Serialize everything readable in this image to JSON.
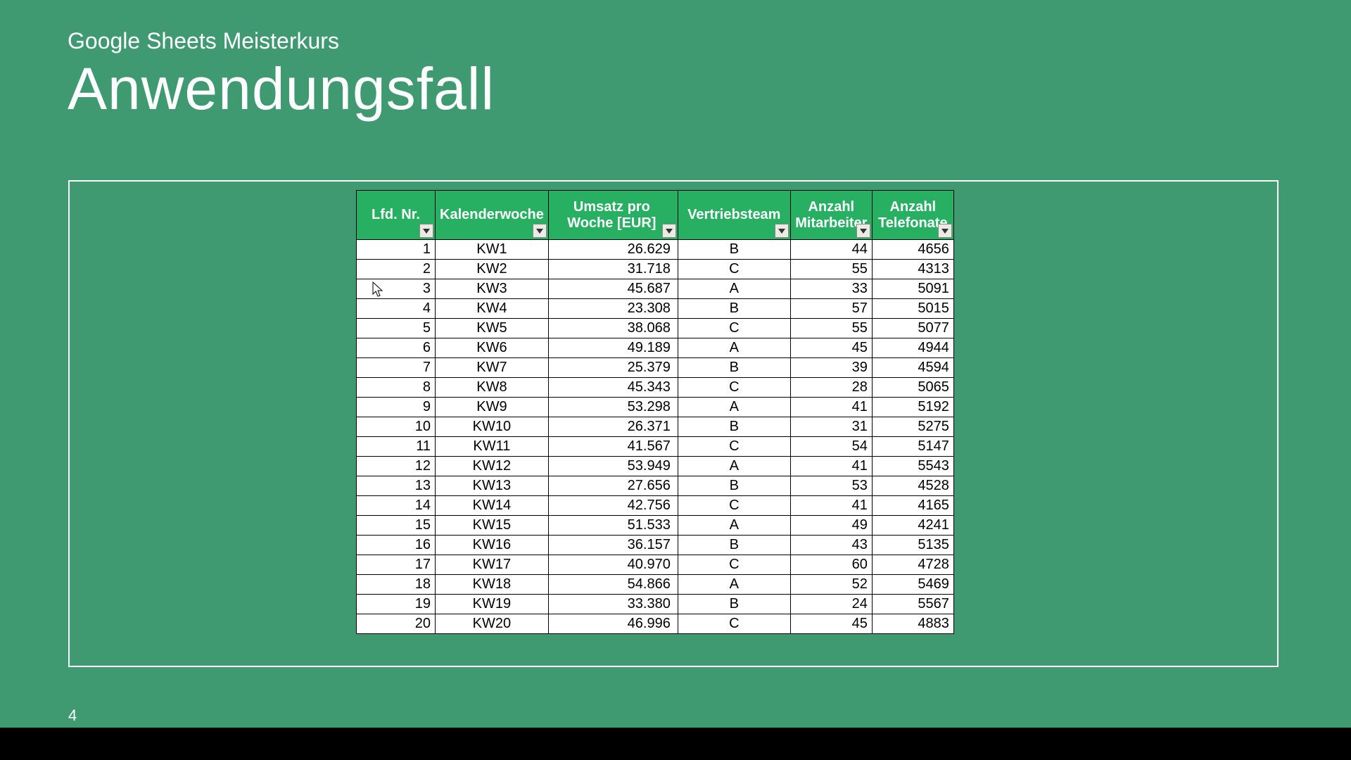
{
  "subtitle": "Google Sheets Meisterkurs",
  "title": "Anwendungsfall",
  "page_number": "4",
  "table": {
    "headers": [
      "Lfd. Nr.",
      "Kalenderwoche",
      "Umsatz pro Woche [EUR]",
      "Vertriebsteam",
      "Anzahl Mitarbeiter",
      "Anzahl Telefonate"
    ],
    "rows": [
      {
        "nr": "1",
        "kw": "KW1",
        "umsatz": "26.629",
        "team": "B",
        "mitarbeiter": "44",
        "telefonate": "4656"
      },
      {
        "nr": "2",
        "kw": "KW2",
        "umsatz": "31.718",
        "team": "C",
        "mitarbeiter": "55",
        "telefonate": "4313"
      },
      {
        "nr": "3",
        "kw": "KW3",
        "umsatz": "45.687",
        "team": "A",
        "mitarbeiter": "33",
        "telefonate": "5091"
      },
      {
        "nr": "4",
        "kw": "KW4",
        "umsatz": "23.308",
        "team": "B",
        "mitarbeiter": "57",
        "telefonate": "5015"
      },
      {
        "nr": "5",
        "kw": "KW5",
        "umsatz": "38.068",
        "team": "C",
        "mitarbeiter": "55",
        "telefonate": "5077"
      },
      {
        "nr": "6",
        "kw": "KW6",
        "umsatz": "49.189",
        "team": "A",
        "mitarbeiter": "45",
        "telefonate": "4944"
      },
      {
        "nr": "7",
        "kw": "KW7",
        "umsatz": "25.379",
        "team": "B",
        "mitarbeiter": "39",
        "telefonate": "4594"
      },
      {
        "nr": "8",
        "kw": "KW8",
        "umsatz": "45.343",
        "team": "C",
        "mitarbeiter": "28",
        "telefonate": "5065"
      },
      {
        "nr": "9",
        "kw": "KW9",
        "umsatz": "53.298",
        "team": "A",
        "mitarbeiter": "41",
        "telefonate": "5192"
      },
      {
        "nr": "10",
        "kw": "KW10",
        "umsatz": "26.371",
        "team": "B",
        "mitarbeiter": "31",
        "telefonate": "5275"
      },
      {
        "nr": "11",
        "kw": "KW11",
        "umsatz": "41.567",
        "team": "C",
        "mitarbeiter": "54",
        "telefonate": "5147"
      },
      {
        "nr": "12",
        "kw": "KW12",
        "umsatz": "53.949",
        "team": "A",
        "mitarbeiter": "41",
        "telefonate": "5543"
      },
      {
        "nr": "13",
        "kw": "KW13",
        "umsatz": "27.656",
        "team": "B",
        "mitarbeiter": "53",
        "telefonate": "4528"
      },
      {
        "nr": "14",
        "kw": "KW14",
        "umsatz": "42.756",
        "team": "C",
        "mitarbeiter": "41",
        "telefonate": "4165"
      },
      {
        "nr": "15",
        "kw": "KW15",
        "umsatz": "51.533",
        "team": "A",
        "mitarbeiter": "49",
        "telefonate": "4241"
      },
      {
        "nr": "16",
        "kw": "KW16",
        "umsatz": "36.157",
        "team": "B",
        "mitarbeiter": "43",
        "telefonate": "5135"
      },
      {
        "nr": "17",
        "kw": "KW17",
        "umsatz": "40.970",
        "team": "C",
        "mitarbeiter": "60",
        "telefonate": "4728"
      },
      {
        "nr": "18",
        "kw": "KW18",
        "umsatz": "54.866",
        "team": "A",
        "mitarbeiter": "52",
        "telefonate": "5469"
      },
      {
        "nr": "19",
        "kw": "KW19",
        "umsatz": "33.380",
        "team": "B",
        "mitarbeiter": "24",
        "telefonate": "5567"
      },
      {
        "nr": "20",
        "kw": "KW20",
        "umsatz": "46.996",
        "team": "C",
        "mitarbeiter": "45",
        "telefonate": "4883"
      }
    ]
  }
}
